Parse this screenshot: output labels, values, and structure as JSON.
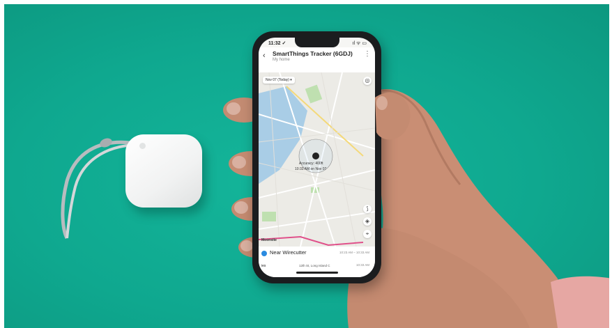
{
  "phone": {
    "status_time": "11:32 ✓",
    "status_right": "ıl ᯤ ▭",
    "app_title": "SmartThings Tracker (6GDJ)",
    "app_subtitle": "My home",
    "date_chip": "Nov 07 (Today)  ▾",
    "location_label": "Accuracy: 400ft",
    "location_time": "10:33 AM on Nov 07",
    "map_corner_label": "Moonsite",
    "rows": [
      {
        "title": "Near Wirecutter",
        "time": "10:23 AM – 10:33 AM"
      },
      {
        "title": "ies",
        "sub": "12th St, Long Island C",
        "time": "10:33 AM"
      }
    ]
  },
  "colors": {
    "background": "#10ab90",
    "tracker": "#f1f2f2",
    "phone_frame": "#1b1d1f",
    "skin": "#c98e74",
    "sleeve": "#e6a7a3"
  },
  "icons": [
    "back-arrow-icon",
    "more-vert-icon",
    "compass-icon",
    "layers-icon",
    "route-icon",
    "locate-icon",
    "location-dot-icon"
  ]
}
